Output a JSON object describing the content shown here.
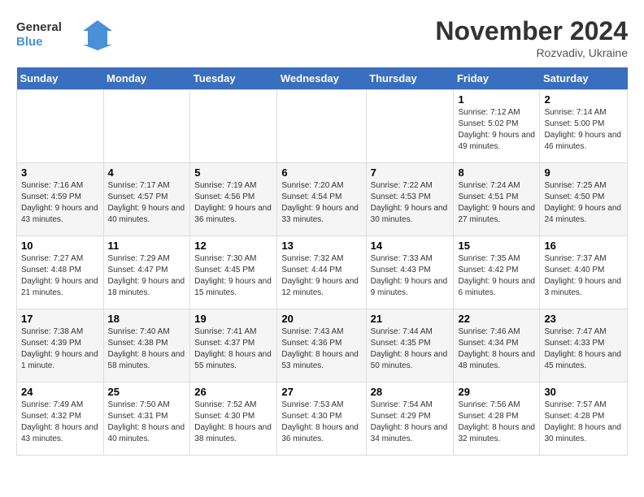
{
  "logo": {
    "line1": "General",
    "line2": "Blue"
  },
  "title": "November 2024",
  "subtitle": "Rozvadiv, Ukraine",
  "days_of_week": [
    "Sunday",
    "Monday",
    "Tuesday",
    "Wednesday",
    "Thursday",
    "Friday",
    "Saturday"
  ],
  "weeks": [
    [
      {
        "day": "",
        "info": ""
      },
      {
        "day": "",
        "info": ""
      },
      {
        "day": "",
        "info": ""
      },
      {
        "day": "",
        "info": ""
      },
      {
        "day": "",
        "info": ""
      },
      {
        "day": "1",
        "info": "Sunrise: 7:12 AM\nSunset: 5:02 PM\nDaylight: 9 hours and 49 minutes."
      },
      {
        "day": "2",
        "info": "Sunrise: 7:14 AM\nSunset: 5:00 PM\nDaylight: 9 hours and 46 minutes."
      }
    ],
    [
      {
        "day": "3",
        "info": "Sunrise: 7:16 AM\nSunset: 4:59 PM\nDaylight: 9 hours and 43 minutes."
      },
      {
        "day": "4",
        "info": "Sunrise: 7:17 AM\nSunset: 4:57 PM\nDaylight: 9 hours and 40 minutes."
      },
      {
        "day": "5",
        "info": "Sunrise: 7:19 AM\nSunset: 4:56 PM\nDaylight: 9 hours and 36 minutes."
      },
      {
        "day": "6",
        "info": "Sunrise: 7:20 AM\nSunset: 4:54 PM\nDaylight: 9 hours and 33 minutes."
      },
      {
        "day": "7",
        "info": "Sunrise: 7:22 AM\nSunset: 4:53 PM\nDaylight: 9 hours and 30 minutes."
      },
      {
        "day": "8",
        "info": "Sunrise: 7:24 AM\nSunset: 4:51 PM\nDaylight: 9 hours and 27 minutes."
      },
      {
        "day": "9",
        "info": "Sunrise: 7:25 AM\nSunset: 4:50 PM\nDaylight: 9 hours and 24 minutes."
      }
    ],
    [
      {
        "day": "10",
        "info": "Sunrise: 7:27 AM\nSunset: 4:48 PM\nDaylight: 9 hours and 21 minutes."
      },
      {
        "day": "11",
        "info": "Sunrise: 7:29 AM\nSunset: 4:47 PM\nDaylight: 9 hours and 18 minutes."
      },
      {
        "day": "12",
        "info": "Sunrise: 7:30 AM\nSunset: 4:45 PM\nDaylight: 9 hours and 15 minutes."
      },
      {
        "day": "13",
        "info": "Sunrise: 7:32 AM\nSunset: 4:44 PM\nDaylight: 9 hours and 12 minutes."
      },
      {
        "day": "14",
        "info": "Sunrise: 7:33 AM\nSunset: 4:43 PM\nDaylight: 9 hours and 9 minutes."
      },
      {
        "day": "15",
        "info": "Sunrise: 7:35 AM\nSunset: 4:42 PM\nDaylight: 9 hours and 6 minutes."
      },
      {
        "day": "16",
        "info": "Sunrise: 7:37 AM\nSunset: 4:40 PM\nDaylight: 9 hours and 3 minutes."
      }
    ],
    [
      {
        "day": "17",
        "info": "Sunrise: 7:38 AM\nSunset: 4:39 PM\nDaylight: 9 hours and 1 minute."
      },
      {
        "day": "18",
        "info": "Sunrise: 7:40 AM\nSunset: 4:38 PM\nDaylight: 8 hours and 58 minutes."
      },
      {
        "day": "19",
        "info": "Sunrise: 7:41 AM\nSunset: 4:37 PM\nDaylight: 8 hours and 55 minutes."
      },
      {
        "day": "20",
        "info": "Sunrise: 7:43 AM\nSunset: 4:36 PM\nDaylight: 8 hours and 53 minutes."
      },
      {
        "day": "21",
        "info": "Sunrise: 7:44 AM\nSunset: 4:35 PM\nDaylight: 8 hours and 50 minutes."
      },
      {
        "day": "22",
        "info": "Sunrise: 7:46 AM\nSunset: 4:34 PM\nDaylight: 8 hours and 48 minutes."
      },
      {
        "day": "23",
        "info": "Sunrise: 7:47 AM\nSunset: 4:33 PM\nDaylight: 8 hours and 45 minutes."
      }
    ],
    [
      {
        "day": "24",
        "info": "Sunrise: 7:49 AM\nSunset: 4:32 PM\nDaylight: 8 hours and 43 minutes."
      },
      {
        "day": "25",
        "info": "Sunrise: 7:50 AM\nSunset: 4:31 PM\nDaylight: 8 hours and 40 minutes."
      },
      {
        "day": "26",
        "info": "Sunrise: 7:52 AM\nSunset: 4:30 PM\nDaylight: 8 hours and 38 minutes."
      },
      {
        "day": "27",
        "info": "Sunrise: 7:53 AM\nSunset: 4:30 PM\nDaylight: 8 hours and 36 minutes."
      },
      {
        "day": "28",
        "info": "Sunrise: 7:54 AM\nSunset: 4:29 PM\nDaylight: 8 hours and 34 minutes."
      },
      {
        "day": "29",
        "info": "Sunrise: 7:56 AM\nSunset: 4:28 PM\nDaylight: 8 hours and 32 minutes."
      },
      {
        "day": "30",
        "info": "Sunrise: 7:57 AM\nSunset: 4:28 PM\nDaylight: 8 hours and 30 minutes."
      }
    ]
  ]
}
